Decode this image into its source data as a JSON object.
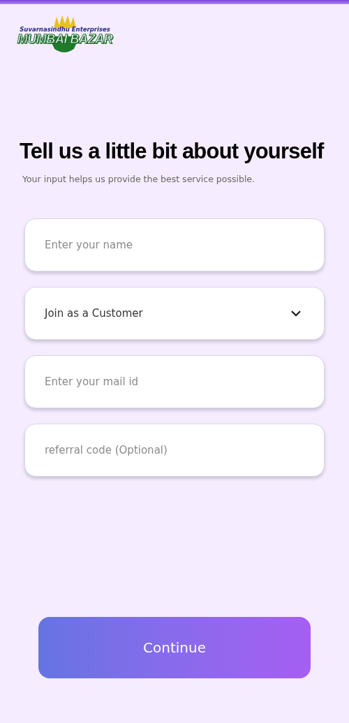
{
  "logo": {
    "tagline": "Suvarnasindhu Enterprises",
    "name": "MUMBAI BAZAR"
  },
  "heading": "Tell us a little bit about yourself",
  "subtitle": "Your input helps us provide the best service possible.",
  "fields": [
    {
      "kind": "input",
      "placeholder": "Enter your name"
    },
    {
      "kind": "select",
      "value": "Join as a Customer"
    },
    {
      "kind": "input",
      "placeholder": "Enter your mail id"
    },
    {
      "kind": "input",
      "placeholder": "referral code (Optional)"
    }
  ],
  "button": "Continue"
}
